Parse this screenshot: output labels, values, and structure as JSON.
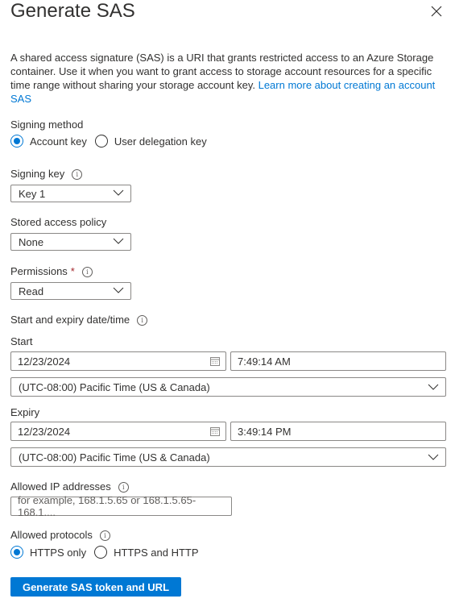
{
  "header": {
    "title": "Generate SAS",
    "close_label": "Close"
  },
  "description": {
    "text": "A shared access signature (SAS) is a URI that grants restricted access to an Azure Storage container. Use it when you want to grant access to storage account resources for a specific time range without sharing your storage account key. ",
    "link_text": "Learn more about creating an account SAS"
  },
  "signing_method": {
    "label": "Signing method",
    "options": [
      {
        "label": "Account key",
        "checked": true
      },
      {
        "label": "User delegation key",
        "checked": false
      }
    ]
  },
  "signing_key": {
    "label": "Signing key",
    "value": "Key 1"
  },
  "stored_access_policy": {
    "label": "Stored access policy",
    "value": "None"
  },
  "permissions": {
    "label": "Permissions",
    "required_mark": "*",
    "value": "Read"
  },
  "date_range": {
    "label": "Start and expiry date/time"
  },
  "start": {
    "label": "Start",
    "date": "12/23/2024",
    "time": "7:49:14 AM",
    "timezone": "(UTC-08:00) Pacific Time (US & Canada)"
  },
  "expiry": {
    "label": "Expiry",
    "date": "12/23/2024",
    "time": "3:49:14 PM",
    "timezone": "(UTC-08:00) Pacific Time (US & Canada)"
  },
  "allowed_ip": {
    "label": "Allowed IP addresses",
    "value": "",
    "placeholder": "for example, 168.1.5.65 or 168.1.5.65-168.1...."
  },
  "allowed_protocols": {
    "label": "Allowed protocols",
    "options": [
      {
        "label": "HTTPS only",
        "checked": true
      },
      {
        "label": "HTTPS and HTTP",
        "checked": false
      }
    ]
  },
  "generate_button": {
    "label": "Generate SAS token and URL"
  },
  "colors": {
    "accent": "#0078d4",
    "text": "#323130",
    "border": "#8a8886",
    "required": "#a4262c"
  }
}
